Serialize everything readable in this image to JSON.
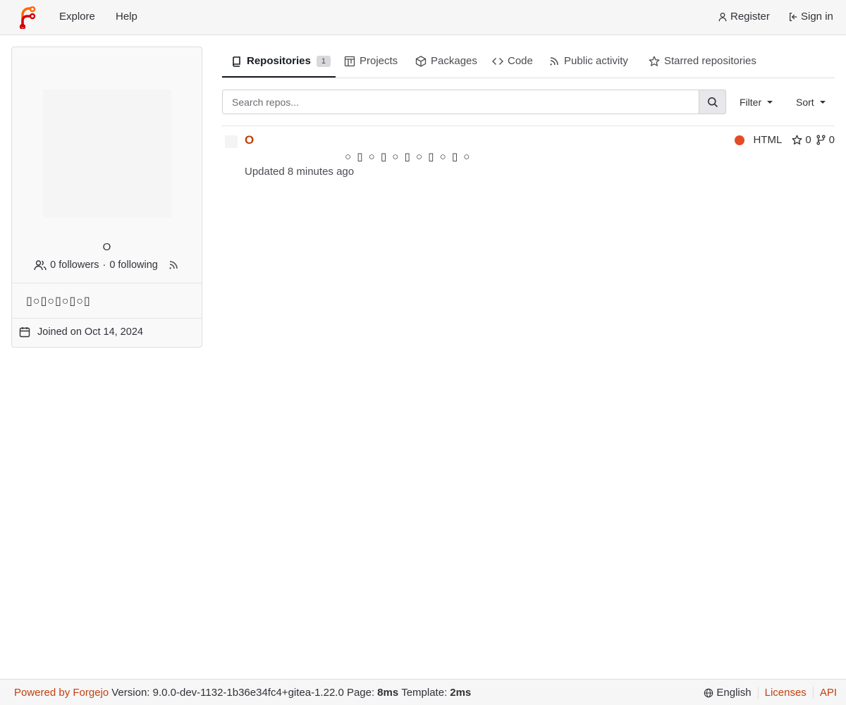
{
  "navbar": {
    "explore_label": "Explore",
    "help_label": "Help",
    "register_label": "Register",
    "signin_label": "Sign in"
  },
  "profile": {
    "name": "O",
    "followers": "0 followers",
    "separator": "·",
    "following": "0 following",
    "bio": "▯○▯○▯○▯○▯",
    "joined": "Joined on Oct 14, 2024"
  },
  "tabs": [
    {
      "label": "Repositories",
      "count": "1",
      "icon": "repo-icon"
    },
    {
      "label": "Projects",
      "icon": "project-icon"
    },
    {
      "label": "Packages",
      "icon": "package-icon"
    },
    {
      "label": "Code",
      "icon": "code-icon"
    },
    {
      "label": "Public activity",
      "icon": "rss-icon"
    },
    {
      "label": "Starred repositories",
      "icon": "star-icon"
    }
  ],
  "search": {
    "placeholder": "Search repos...",
    "filter_label": "Filter",
    "sort_label": "Sort"
  },
  "repo": {
    "name": "O",
    "description": "○ ▯ ○ ▯ ○ ▯ ○ ▯ ○ ▯ ○",
    "updated": "Updated 8 minutes ago",
    "language": "HTML",
    "language_color": "#e34c26",
    "stars": "0",
    "forks": "0"
  },
  "footer": {
    "powered_by": "Powered by Forgejo",
    "version_text": "Version: 9.0.0-dev-1132-1b36e34fc4+gitea-1.22.0 Page:",
    "page_time": "8ms",
    "template_label": "Template:",
    "template_time": "2ms",
    "language": "English",
    "licenses": "Licenses",
    "api": "API"
  },
  "colors": {
    "accent": "#c2410c",
    "logo_orange": "#ff6600",
    "logo_red": "#d40000"
  }
}
